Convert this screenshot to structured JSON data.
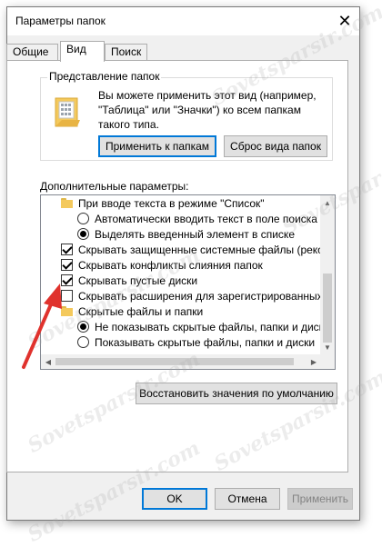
{
  "window": {
    "title": "Параметры папок",
    "close_glyph": "✕"
  },
  "tabs": [
    {
      "label": "Общие"
    },
    {
      "label": "Вид"
    },
    {
      "label": "Поиск"
    }
  ],
  "folder_views": {
    "label": "Представление папок",
    "description": "Вы можете применить этот вид (например, \"Таблица\" или \"Значки\") ко всем папкам такого типа.",
    "apply_button": "Применить к папкам",
    "reset_button": "Сброс вида папок"
  },
  "advanced": {
    "label": "Дополнительные параметры:",
    "items": [
      {
        "type": "folder",
        "text": "При вводе текста в режиме \"Список\""
      },
      {
        "type": "radio",
        "checked": false,
        "text": "Автоматически вводить текст в поле поиска"
      },
      {
        "type": "radio",
        "checked": true,
        "text": "Выделять введенный элемент в списке"
      },
      {
        "type": "checkbox",
        "checked": true,
        "text": "Скрывать защищенные системные файлы (рекомен"
      },
      {
        "type": "checkbox",
        "checked": true,
        "text": "Скрывать конфликты слияния папок"
      },
      {
        "type": "checkbox",
        "checked": true,
        "text": "Скрывать пустые диски"
      },
      {
        "type": "checkbox",
        "checked": false,
        "text": "Скрывать расширения для зарегистрированных типо"
      },
      {
        "type": "folder",
        "text": "Скрытые файлы и папки"
      },
      {
        "type": "radio",
        "checked": true,
        "text": "Не показывать скрытые файлы, папки и диски"
      },
      {
        "type": "radio",
        "checked": false,
        "text": "Показывать скрытые файлы, папки и диски"
      }
    ],
    "restore_button": "Восстановить значения по умолчанию"
  },
  "footer": {
    "ok": "OK",
    "cancel": "Отмена",
    "apply": "Применить"
  },
  "watermark_text": "Sovetsparsir.com",
  "colors": {
    "accent": "#0078d7",
    "annotation_arrow": "#e0322d",
    "folder": "#f4c95c"
  }
}
